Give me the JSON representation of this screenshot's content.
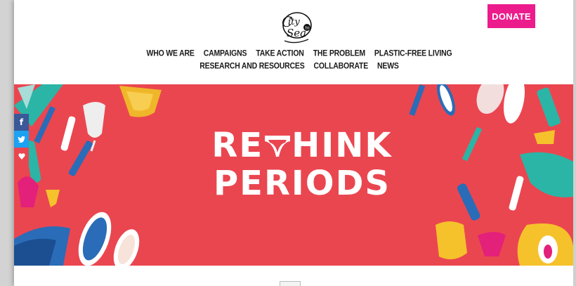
{
  "header": {
    "logo_text": "City to Sea",
    "donate_label": "DONATE"
  },
  "nav": {
    "items": [
      {
        "label": "WHO WE ARE"
      },
      {
        "label": "CAMPAIGNS"
      },
      {
        "label": "TAKE ACTION"
      },
      {
        "label": "THE PROBLEM"
      },
      {
        "label": "PLASTIC-FREE LIVING"
      },
      {
        "label": "RESEARCH AND RESOURCES"
      },
      {
        "label": "COLLABORATE"
      },
      {
        "label": "NEWS"
      }
    ]
  },
  "hero": {
    "title_line1": "RE",
    "title_line1_rest": "HINK",
    "title_line2": "PERIODS",
    "background_color": "#ea4650"
  },
  "share": {
    "facebook_glyph": "f",
    "twitter_icon": "twitter-icon",
    "heart_icon": "heart-icon"
  },
  "colors": {
    "accent": "#ec1c8c",
    "hero": "#ea4650",
    "facebook": "#3b5998",
    "twitter": "#1da1f2"
  }
}
